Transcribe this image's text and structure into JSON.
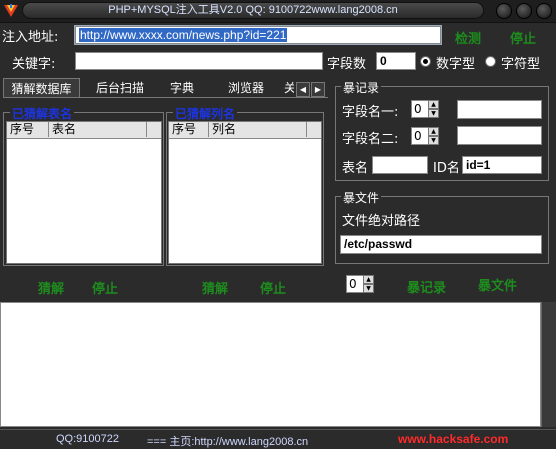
{
  "window": {
    "title": "PHP+MYSQL注入工具V2.0  QQ: 9100722www.lang2008.cn"
  },
  "form": {
    "url_label": "注入地址:",
    "url_value": "http://www.xxxx.com/news.php?id=221",
    "keyword_label": "关键字:",
    "keyword_value": "",
    "field_count_label": "字段数",
    "field_count_value": "0",
    "numeric_label": "数字型",
    "string_label": "字符型",
    "numeric_selected": true,
    "detect_button": "检测",
    "stop_button": "停止"
  },
  "tabs": [
    "猜解数据库",
    "后台扫描",
    "字典",
    "浏览器",
    "关"
  ],
  "tables_panel": {
    "title": "已猜解表名",
    "col_index": "序号",
    "col_name": "表名",
    "guess_button": "猜解",
    "stop_button": "停止"
  },
  "columns_panel": {
    "title": "已猜解列名",
    "col_index": "序号",
    "col_name": "列名",
    "guess_button": "猜解",
    "stop_button": "停止"
  },
  "records_panel": {
    "title": "暴记录",
    "field1_label": "字段名一:",
    "field1_spin": "0",
    "field1_value": "",
    "field2_label": "字段名二:",
    "field2_spin": "0",
    "field2_value": "",
    "table_label": "表名",
    "table_value": "",
    "id_label": "ID名",
    "id_value": "id=1"
  },
  "files_panel": {
    "title": "暴文件",
    "path_label": "文件绝对路径",
    "path_value": "/etc/passwd"
  },
  "bottom_controls": {
    "spin_value": "0",
    "dump_records_button": "暴记录",
    "dump_file_button": "暴文件"
  },
  "status": {
    "qq": "QQ:9100722",
    "homepage": "=== 主页:http://www.lang2008.cn",
    "watermark": "www.hacksafe.com"
  },
  "colors": {
    "background": "#2b2b2b",
    "button_text": "#1e8b1e",
    "group_title_blue": "#1c34e0",
    "watermark": "#ff2a2a"
  }
}
